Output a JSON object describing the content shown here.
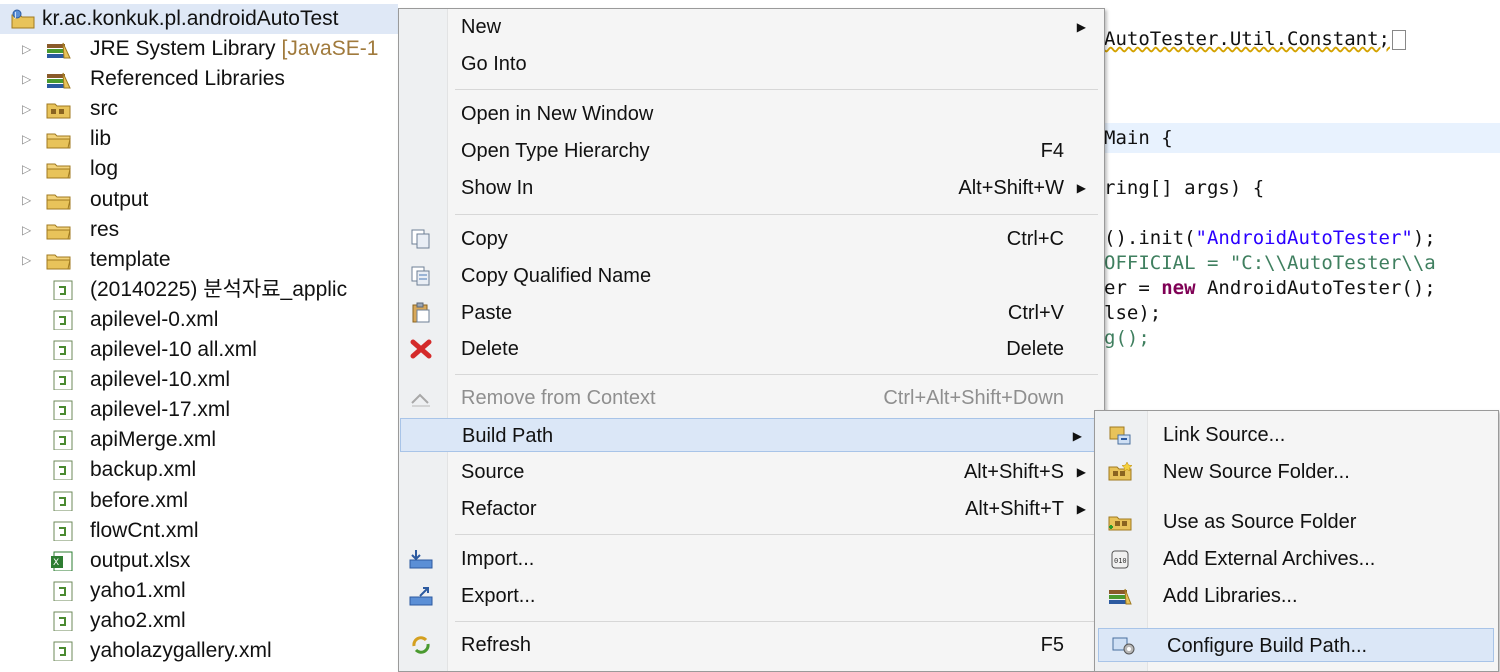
{
  "explorer": {
    "root": {
      "label": "kr.ac.konkuk.pl.androidAutoTest"
    },
    "items": [
      {
        "label": "JRE System Library",
        "suffix": "[JavaSE-1",
        "icon": "library-icon",
        "twisty": "▷"
      },
      {
        "label": "Referenced Libraries",
        "icon": "library-icon",
        "twisty": "▷"
      },
      {
        "label": "src",
        "icon": "source-folder-icon",
        "twisty": "▷"
      },
      {
        "label": "lib",
        "icon": "folder-icon",
        "twisty": "▷"
      },
      {
        "label": "log",
        "icon": "folder-icon",
        "twisty": "▷"
      },
      {
        "label": "output",
        "icon": "folder-icon",
        "twisty": "▷"
      },
      {
        "label": "res",
        "icon": "folder-icon",
        "twisty": "▷"
      },
      {
        "label": "template",
        "icon": "folder-icon",
        "twisty": "▷"
      },
      {
        "label": "(20140225) 분석자료_applic",
        "icon": "xml-file-icon"
      },
      {
        "label": "apilevel-0.xml",
        "icon": "xml-file-icon"
      },
      {
        "label": "apilevel-10 all.xml",
        "icon": "xml-file-icon"
      },
      {
        "label": "apilevel-10.xml",
        "icon": "xml-file-icon"
      },
      {
        "label": "apilevel-17.xml",
        "icon": "xml-file-icon"
      },
      {
        "label": "apiMerge.xml",
        "icon": "xml-file-icon"
      },
      {
        "label": "backup.xml",
        "icon": "xml-file-icon"
      },
      {
        "label": "before.xml",
        "icon": "xml-file-icon"
      },
      {
        "label": "flowCnt.xml",
        "icon": "xml-file-icon"
      },
      {
        "label": "output.xlsx",
        "icon": "excel-file-icon"
      },
      {
        "label": "yaho1.xml",
        "icon": "xml-file-icon"
      },
      {
        "label": "yaho2.xml",
        "icon": "xml-file-icon"
      },
      {
        "label": "yaholazygallery.xml",
        "icon": "xml-file-icon"
      }
    ]
  },
  "editor": {
    "line1": "AutoTester.Util.Constant;",
    "line2a": "Main {",
    "line3a": "ring[] args) {",
    "line4a": "().init(",
    "line4b": "\"AndroidAutoTester\"",
    "line4c": ");",
    "line5a": "OFFICIAL = ",
    "line5b": "\"C:\\\\AutoTester\\\\a",
    "line6a": "er = ",
    "line6b": "new",
    "line6c": " AndroidAutoTester();",
    "line7": "lse);",
    "line8": "g();"
  },
  "context_menu": {
    "new": {
      "label": "New"
    },
    "go_into": {
      "label": "Go Into"
    },
    "open_new_window": {
      "label": "Open in New Window"
    },
    "open_type_hierarchy": {
      "label": "Open Type Hierarchy",
      "shortcut": "F4"
    },
    "show_in": {
      "label": "Show In",
      "shortcut": "Alt+Shift+W"
    },
    "copy": {
      "label": "Copy",
      "shortcut": "Ctrl+C"
    },
    "copy_qualified": {
      "label": "Copy Qualified Name"
    },
    "paste": {
      "label": "Paste",
      "shortcut": "Ctrl+V"
    },
    "delete": {
      "label": "Delete",
      "shortcut": "Delete"
    },
    "remove_context": {
      "label": "Remove from Context",
      "shortcut": "Ctrl+Alt+Shift+Down"
    },
    "build_path": {
      "label": "Build Path"
    },
    "source": {
      "label": "Source",
      "shortcut": "Alt+Shift+S"
    },
    "refactor": {
      "label": "Refactor",
      "shortcut": "Alt+Shift+T"
    },
    "import": {
      "label": "Import..."
    },
    "export": {
      "label": "Export..."
    },
    "refresh": {
      "label": "Refresh",
      "shortcut": "F5"
    },
    "arrow": "▶"
  },
  "submenu": {
    "link_source": {
      "label": "Link Source..."
    },
    "new_source_folder": {
      "label": "New Source Folder..."
    },
    "use_as_source": {
      "label": "Use as Source Folder"
    },
    "add_external_archives": {
      "label": "Add External Archives..."
    },
    "add_libraries": {
      "label": "Add Libraries..."
    },
    "configure_build_path": {
      "label": "Configure Build Path..."
    }
  },
  "colors": {
    "menu_bg": "#f5f5f5",
    "highlight": "#dbe7f7",
    "keyword": "#7f0055",
    "string": "#2a00ff",
    "comment": "#3f7f5f"
  }
}
